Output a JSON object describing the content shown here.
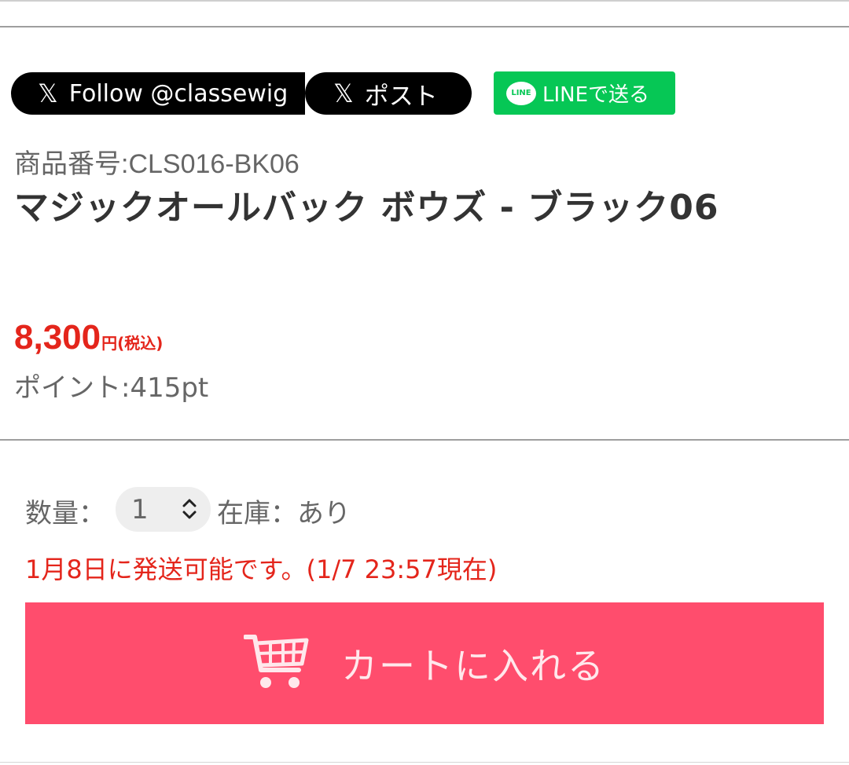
{
  "social": {
    "x_follow_label": "Follow @classewig",
    "x_post_label": "ポスト",
    "x_glyph": "𝕏",
    "line_icon_text": "LINE",
    "line_label": "LINEで送る"
  },
  "product": {
    "code": "商品番号:CLS016-BK06",
    "name": "マジックオールバック ボウズ - ブラック06",
    "price": "8,300",
    "price_unit": "円(税込)",
    "points": "ポイント:415pt"
  },
  "purchase": {
    "qty_label": "数量：",
    "qty_value": "1",
    "stock": "在庫：あり",
    "shipping": "1月8日に発送可能です。(1/7 23:57現在)",
    "cart_label": "カートに入れる"
  },
  "colors": {
    "price_red": "#e4251b",
    "cart_pink": "#ff4d6d",
    "line_green": "#06c755"
  }
}
